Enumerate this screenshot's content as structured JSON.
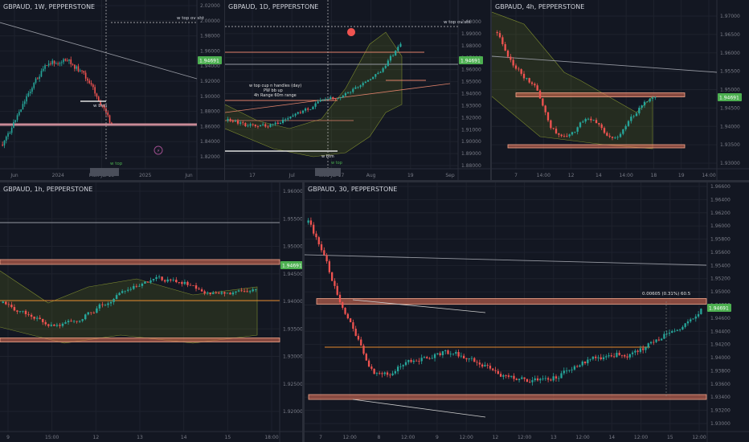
{
  "colors": {
    "bg": "#131722",
    "axis": "#787b86",
    "grid": "#1e222d",
    "up": "#26a69a",
    "down": "#ef5350",
    "green": "#4caf50",
    "orange": "#f57c00",
    "band": "#f4a58a",
    "price_tag": "#4caf50",
    "gray_line": "#9598a1",
    "ma": "#e58a2c"
  },
  "panes": [
    {
      "title": "GBPAUD, 1W, PEPPERSTONE",
      "y_ticks": [
        "2.02000",
        "2.00000",
        "1.98000",
        "1.96000",
        "1.94000",
        "1.92000",
        "1.90000",
        "1.88000",
        "1.86000",
        "1.84000",
        "1.82000"
      ],
      "x_ticks": [
        "Jun",
        "2024",
        "Mon Jul 15",
        "2025",
        "Jun"
      ],
      "price_tag": "1.94691",
      "annotations": [
        "w top ov sht",
        "w btm",
        "w top"
      ]
    },
    {
      "title": "GBPAUD, 1D, PEPPERSTONE",
      "y_ticks": [
        "2.00000",
        "1.99000",
        "1.98000",
        "1.97000",
        "1.96000",
        "1.95000",
        "1.94000",
        "1.93000",
        "1.92000",
        "1.91000",
        "1.90000",
        "1.89000",
        "1.88000"
      ],
      "x_ticks": [
        "17",
        "Jul",
        "Wed Jul 17",
        "Aug",
        "19",
        "Sep"
      ],
      "price_tag": "1.94691",
      "annotations": [
        "w top ov sht",
        "w top cup n handles (day)",
        "PW bb up",
        "4h Range 60m range",
        "w btm",
        "w top"
      ]
    },
    {
      "title": "GBPAUD, 4h, PEPPERSTONE",
      "y_ticks": [
        "1.97000",
        "1.96500",
        "1.96000",
        "1.95500",
        "1.95000",
        "1.94500",
        "1.94000",
        "1.93500",
        "1.93000"
      ],
      "x_ticks": [
        "7",
        "14:00",
        "12",
        "14",
        "14:00",
        "18",
        "19",
        "14:00"
      ],
      "price_tag": "1.94691",
      "annotations": []
    },
    {
      "title": "GBPAUD, 1h, PEPPERSTONE",
      "y_ticks": [
        "1.96000",
        "1.95500",
        "1.95000",
        "1.94500",
        "1.94000",
        "1.93500",
        "1.93000",
        "1.92500",
        "1.92000"
      ],
      "x_ticks": [
        "9",
        "15:00",
        "12",
        "13",
        "14",
        "15",
        "18:00"
      ],
      "price_tag": "1.94691",
      "annotations": []
    },
    {
      "title": "GBPAUD, 30, PEPPERSTONE",
      "y_ticks": [
        "1.96600",
        "1.96400",
        "1.96200",
        "1.96000",
        "1.95800",
        "1.95600",
        "1.95400",
        "1.95200",
        "1.95000",
        "1.94800",
        "1.94600",
        "1.94400",
        "1.94200",
        "1.94000",
        "1.93800",
        "1.93600",
        "1.93400",
        "1.93200",
        "1.93000"
      ],
      "x_ticks": [
        "7",
        "12:00",
        "8",
        "12:00",
        "9",
        "12:00",
        "12",
        "12:00",
        "13",
        "12:00",
        "14",
        "12:00",
        "15",
        "12:00"
      ],
      "price_tag": "1.94691",
      "measure_label": "0.00605 (0.31%) 60.5",
      "annotations": []
    }
  ]
}
